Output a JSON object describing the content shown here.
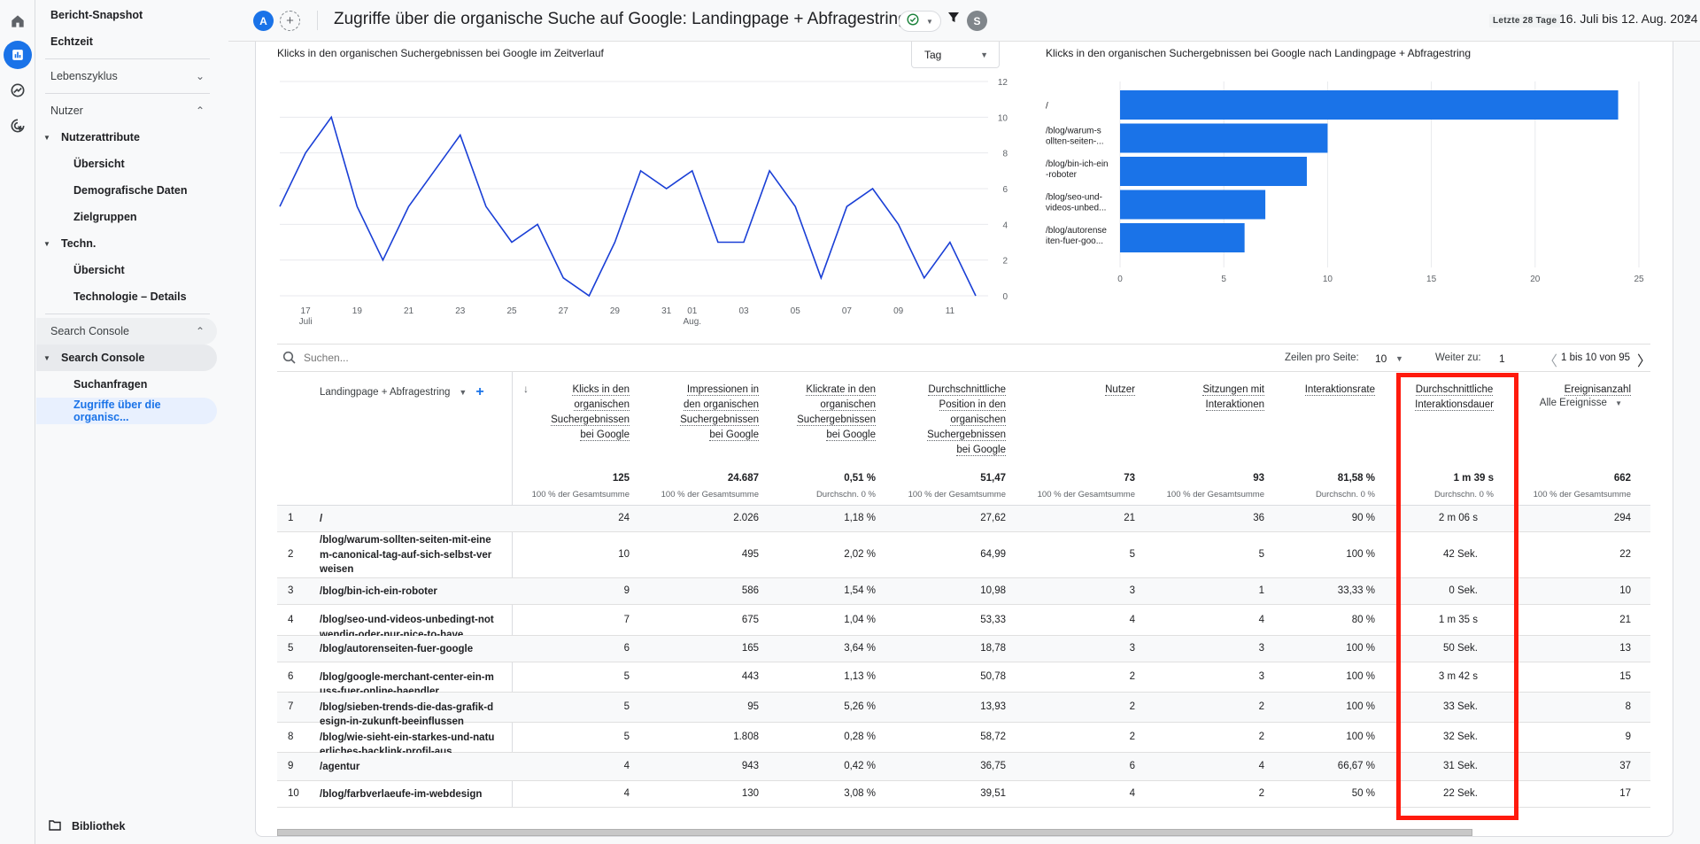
{
  "rail": {
    "icons": [
      "home-icon",
      "reports-icon",
      "explore-icon",
      "advertising-icon"
    ]
  },
  "sidebar": {
    "items": [
      {
        "label": "Bericht-Snapshot"
      },
      {
        "label": "Echtzeit"
      },
      {
        "label": "Lebenszyklus"
      },
      {
        "label": "Nutzer"
      },
      {
        "label": "Nutzerattribute"
      },
      {
        "label": "Übersicht"
      },
      {
        "label": "Demografische Daten"
      },
      {
        "label": "Zielgruppen"
      },
      {
        "label": "Techn."
      },
      {
        "label": "Übersicht"
      },
      {
        "label": "Technologie – Details"
      },
      {
        "label": "Search Console"
      },
      {
        "label": "Search Console"
      },
      {
        "label": "Suchanfragen"
      },
      {
        "label": "Zugriffe über die organisc..."
      }
    ],
    "footer_label": "Bibliothek"
  },
  "header": {
    "avatar_initial": "A",
    "add_compare_symbol": "+",
    "title": "Zugriffe über die organische Suche auf Google: Landingpage + Abfragestring",
    "user_initial": "S",
    "date_label": "Letzte 28 Tage",
    "date_range": "16. Juli bis 12. Aug. 2024"
  },
  "colors": {
    "accent": "#1a73e8",
    "line": "#1a3fd6",
    "highlight": "#ff1a0d"
  },
  "chart_data": [
    {
      "type": "line",
      "title": "Klicks in den organischen Suchergebnissen bei Google im Zeitverlauf",
      "granularity_select": "Tag",
      "x": [
        "16",
        "17",
        "18",
        "19",
        "20",
        "21",
        "22",
        "23",
        "24",
        "25",
        "26",
        "27",
        "28",
        "29",
        "30",
        "31",
        "01",
        "02",
        "03",
        "04",
        "05",
        "06",
        "07",
        "08",
        "09",
        "10",
        "11",
        "12"
      ],
      "x_tick_labels": [
        {
          "index": 1,
          "label": "17",
          "sub": "Juli"
        },
        {
          "index": 3,
          "label": "19"
        },
        {
          "index": 5,
          "label": "21"
        },
        {
          "index": 7,
          "label": "23"
        },
        {
          "index": 9,
          "label": "25"
        },
        {
          "index": 11,
          "label": "27"
        },
        {
          "index": 13,
          "label": "29"
        },
        {
          "index": 15,
          "label": "31"
        },
        {
          "index": 16,
          "label": "01",
          "sub": "Aug."
        },
        {
          "index": 18,
          "label": "03"
        },
        {
          "index": 20,
          "label": "05"
        },
        {
          "index": 22,
          "label": "07"
        },
        {
          "index": 24,
          "label": "09"
        },
        {
          "index": 26,
          "label": "11"
        }
      ],
      "series": [
        {
          "name": "Klicks",
          "values": [
            5,
            8,
            10,
            5,
            2,
            5,
            7,
            9,
            5,
            3,
            4,
            1,
            0,
            3,
            7,
            6,
            7,
            3,
            3,
            7,
            5,
            1,
            5,
            6,
            4,
            1,
            3,
            0
          ]
        }
      ],
      "ylim": [
        0,
        12
      ],
      "y_ticks": [
        0,
        2,
        4,
        6,
        8,
        10,
        12
      ],
      "y_axis_side": "right",
      "grid": true
    },
    {
      "type": "bar",
      "orientation": "horizontal",
      "title": "Klicks in den organischen Suchergebnissen bei Google nach Landingpage + Abfragestring",
      "categories": [
        [
          "/"
        ],
        [
          "/blog/warum-s",
          "ollten-seiten-..."
        ],
        [
          "/blog/bin-ich-ein",
          "-roboter"
        ],
        [
          "/blog/seo-und-",
          "videos-unbed..."
        ],
        [
          "/blog/autorense",
          "iten-fuer-goo..."
        ]
      ],
      "values": [
        24,
        10,
        9,
        7,
        6
      ],
      "xlim": [
        0,
        25
      ],
      "x_ticks": [
        0,
        5,
        10,
        15,
        20,
        25
      ],
      "grid": true
    }
  ],
  "table": {
    "search_placeholder": "Suchen...",
    "rows_per_page_label": "Zeilen pro Seite:",
    "rows_per_page_value": "10",
    "goto_label": "Weiter zu:",
    "goto_value": "1",
    "page_info": "1 bis 10 von 95",
    "dimension_header": "Landingpage + Abfragestring",
    "event_filter": "Alle Ereignisse",
    "columns": [
      {
        "lines": [
          "Klicks in den",
          "organischen",
          "Suchergebnissen",
          "bei Google"
        ],
        "total": "125",
        "sub": "100 % der Gesamtsumme"
      },
      {
        "lines": [
          "Impressionen in",
          "den organischen",
          "Suchergebnissen",
          "bei Google"
        ],
        "total": "24.687",
        "sub": "100 % der Gesamtsumme"
      },
      {
        "lines": [
          "Klickrate in den",
          "organischen",
          "Suchergebnissen",
          "bei Google"
        ],
        "total": "0,51 %",
        "sub": "Durchschn. 0 %"
      },
      {
        "lines": [
          "Durchschnittliche",
          "Position in den",
          "organischen",
          "Suchergebnissen",
          "bei Google"
        ],
        "total": "51,47",
        "sub": "100 % der Gesamtsumme"
      },
      {
        "lines": [
          "Nutzer"
        ],
        "total": "73",
        "sub": "100 % der Gesamtsumme"
      },
      {
        "lines": [
          "Sitzungen mit",
          "Interaktionen"
        ],
        "total": "93",
        "sub": "100 % der Gesamtsumme"
      },
      {
        "lines": [
          "Interaktionsrate"
        ],
        "total": "81,58 %",
        "sub": "Durchschn. 0 %"
      },
      {
        "lines": [
          "Durchschnittliche",
          "Interaktionsdauer"
        ],
        "total": "1 m 39 s",
        "sub": "Durchschn. 0 %"
      },
      {
        "lines": [
          "Ereignisanzahl"
        ],
        "total": "662",
        "sub": "100 % der Gesamtsumme"
      }
    ],
    "rows": [
      {
        "n": "1",
        "page": "/",
        "v": [
          "24",
          "2.026",
          "1,18 %",
          "27,62",
          "21",
          "36",
          "90 %",
          "2 m 06 s",
          "294"
        ]
      },
      {
        "n": "2",
        "page": "/blog/warum-sollten-seiten-mit-einem-canonical-tag-auf-sich-selbst-verweisen",
        "v": [
          "10",
          "495",
          "2,02 %",
          "64,99",
          "5",
          "5",
          "100 %",
          "42 Sek.",
          "22"
        ]
      },
      {
        "n": "3",
        "page": "/blog/bin-ich-ein-roboter",
        "v": [
          "9",
          "586",
          "1,54 %",
          "10,98",
          "3",
          "1",
          "33,33 %",
          "0 Sek.",
          "10"
        ]
      },
      {
        "n": "4",
        "page": "/blog/seo-und-videos-unbedingt-notwendig-oder-nur-nice-to-have",
        "v": [
          "7",
          "675",
          "1,04 %",
          "53,33",
          "4",
          "4",
          "80 %",
          "1 m 35 s",
          "21"
        ]
      },
      {
        "n": "5",
        "page": "/blog/autorenseiten-fuer-google",
        "v": [
          "6",
          "165",
          "3,64 %",
          "18,78",
          "3",
          "3",
          "100 %",
          "50 Sek.",
          "13"
        ]
      },
      {
        "n": "6",
        "page": "/blog/google-merchant-center-ein-muss-fuer-online-haendler",
        "v": [
          "5",
          "443",
          "1,13 %",
          "50,78",
          "2",
          "3",
          "100 %",
          "3 m 42 s",
          "15"
        ]
      },
      {
        "n": "7",
        "page": "/blog/sieben-trends-die-das-grafik-design-in-zukunft-beeinflussen",
        "v": [
          "5",
          "95",
          "5,26 %",
          "13,93",
          "2",
          "2",
          "100 %",
          "33 Sek.",
          "8"
        ]
      },
      {
        "n": "8",
        "page": "/blog/wie-sieht-ein-starkes-und-natuerliches-backlink-profil-aus",
        "v": [
          "5",
          "1.808",
          "0,28 %",
          "58,72",
          "2",
          "2",
          "100 %",
          "32 Sek.",
          "9"
        ]
      },
      {
        "n": "9",
        "page": "/agentur",
        "v": [
          "4",
          "943",
          "0,42 %",
          "36,75",
          "6",
          "4",
          "66,67 %",
          "31 Sek.",
          "37"
        ]
      },
      {
        "n": "10",
        "page": "/blog/farbverlaeufe-im-webdesign",
        "v": [
          "4",
          "130",
          "3,08 %",
          "39,51",
          "4",
          "2",
          "50 %",
          "22 Sek.",
          "17"
        ]
      }
    ]
  }
}
